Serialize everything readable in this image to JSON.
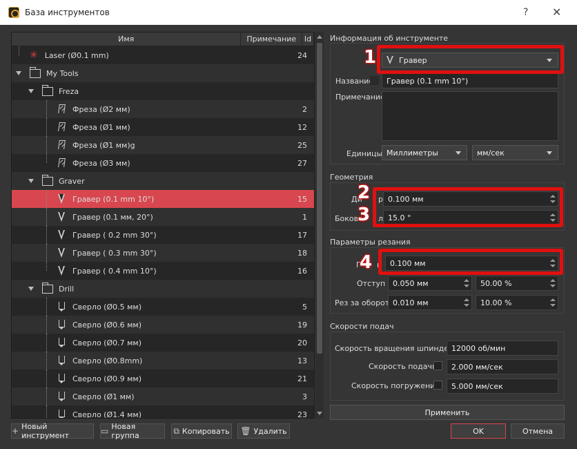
{
  "window": {
    "title": "База инструментов",
    "help_glyph": "?",
    "close_glyph": "✕"
  },
  "tree": {
    "headers": {
      "name": "Имя",
      "note": "Примечание",
      "id": "Id"
    },
    "rows": [
      {
        "label": "Laser (Ø0.1 mm)",
        "id": "24",
        "icon": "laser-icon"
      },
      {
        "label": "My Tools",
        "id": "",
        "icon": "folder-icon"
      },
      {
        "label": "Freza",
        "id": "",
        "icon": "folder-icon"
      },
      {
        "label": "Фреза (Ø2 мм)",
        "id": "2",
        "icon": "end-mill-icon"
      },
      {
        "label": "Фреза (Ø1 мм)",
        "id": "12",
        "icon": "end-mill-icon"
      },
      {
        "label": "Фреза (Ø1 мм)g",
        "id": "25",
        "icon": "end-mill-icon"
      },
      {
        "label": "Фреза (Ø3 мм)",
        "id": "27",
        "icon": "end-mill-icon"
      },
      {
        "label": "Graver",
        "id": "",
        "icon": "folder-icon"
      },
      {
        "label": "Гравер (0.1 mm 10°)",
        "id": "15",
        "icon": "v-bit-icon"
      },
      {
        "label": "Гравер (0.1 мм, 20°)",
        "id": "1",
        "icon": "v-bit-icon"
      },
      {
        "label": "Гравер ( 0.2 mm 30°)",
        "id": "17",
        "icon": "v-bit-icon"
      },
      {
        "label": "Гравер ( 0.3 mm 30°)",
        "id": "18",
        "icon": "v-bit-icon"
      },
      {
        "label": "Гравер ( 0.4 mm 10°)",
        "id": "16",
        "icon": "v-bit-icon"
      },
      {
        "label": "Drill",
        "id": "",
        "icon": "folder-icon"
      },
      {
        "label": "Сверло (Ø0.5 мм)",
        "id": "5",
        "icon": "drill-icon"
      },
      {
        "label": "Сверло (Ø0.6 мм)",
        "id": "19",
        "icon": "drill-icon"
      },
      {
        "label": "Сверло (Ø0.7 мм)",
        "id": "20",
        "icon": "drill-icon"
      },
      {
        "label": "Сверло (Ø0.8mm)",
        "id": "13",
        "icon": "drill-icon"
      },
      {
        "label": "Сверло (Ø0.9 мм)",
        "id": "21",
        "icon": "drill-icon"
      },
      {
        "label": "Сверло (Ø1 мм)",
        "id": "3",
        "icon": "drill-icon"
      },
      {
        "label": "Сверло (Ø1.4 мм)",
        "id": "23",
        "icon": "drill-icon"
      }
    ]
  },
  "info": {
    "section_title": "Информация об инструменте",
    "type_value": "Гравер",
    "name_label": "Название",
    "name_value": "Гравер (0.1 mm 10°)",
    "note_label": "Примечание",
    "units_label": "Единицы",
    "units_value": "Миллиметры",
    "speed_units_value": "мм/сек"
  },
  "geometry": {
    "section_title": "Геометрия",
    "diameter_label": "Ди",
    "diameter_label_tail": "р",
    "diameter_value": "0.100 мм",
    "side_label": "Боково",
    "side_label_tail": "л",
    "side_value": "15.0 °"
  },
  "cutting": {
    "section_title": "Параметры резания",
    "depth_label": "Г",
    "depth_label_tail": "н",
    "depth_value": "0.100 мм",
    "offset_label": "Отступ",
    "offset_value": "0.050 мм",
    "offset_pct": "50.00 %",
    "per_rev_label": "Рез за оборот",
    "per_rev_value": "0.010 мм",
    "per_rev_pct": "10.00 %"
  },
  "feeds": {
    "section_title": "Скорости подач",
    "spindle_label": "Скорость вращения шпинделя",
    "spindle_value": "12000 об/мин",
    "feed_label": "Скорость подачи",
    "feed_value": "2.000 мм/сек",
    "plunge_label": "Скорость погружения",
    "plunge_value": "5.000 мм/сек"
  },
  "buttons": {
    "apply": "Применить",
    "new_tool": "Новый инструмент",
    "new_group": "Новая группа",
    "copy": "Копировать",
    "delete": "Удалить",
    "ok": "OK",
    "cancel": "Отмена"
  },
  "badges": {
    "b1": "1",
    "b2": "2",
    "b3": "3",
    "b4": "4"
  },
  "colors": {
    "selection": "#d8474f",
    "highlight": "#e01010",
    "background": "#353535"
  }
}
